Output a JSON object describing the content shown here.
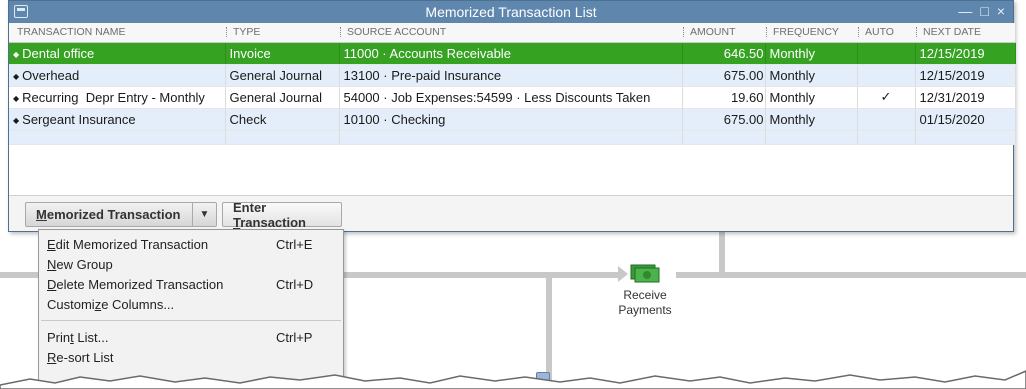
{
  "window": {
    "title": "Memorized Transaction List",
    "controls": [
      "—",
      "□",
      "×"
    ]
  },
  "table": {
    "columns": [
      "TRANSACTION NAME",
      "TYPE",
      "SOURCE ACCOUNT",
      "AMOUNT",
      "FREQUENCY",
      "AUTO",
      "NEXT DATE"
    ],
    "rows": [
      {
        "name": "Dental office",
        "type": "Invoice",
        "account": "11000 · Accounts Receivable",
        "amount": "646.50",
        "frequency": "Monthly",
        "auto": "",
        "next_date": "12/15/2019",
        "selected": true
      },
      {
        "name": "Overhead",
        "type": "General Journal",
        "account": "13100 · Pre-paid Insurance",
        "amount": "675.00",
        "frequency": "Monthly",
        "auto": "",
        "next_date": "12/15/2019",
        "selected": false
      },
      {
        "name": "Recurring  Depr Entry - Monthly",
        "type": "General Journal",
        "account": "54000 · Job Expenses:54599 · Less Discounts Taken",
        "amount": "19.60",
        "frequency": "Monthly",
        "auto": "✓",
        "next_date": "12/31/2019",
        "selected": false
      },
      {
        "name": "Sergeant Insurance",
        "type": "Check",
        "account": "10100 · Checking",
        "amount": "675.00",
        "frequency": "Monthly",
        "auto": "",
        "next_date": "01/15/2020",
        "selected": false
      }
    ]
  },
  "buttons": {
    "memorized_pre": "",
    "memorized_u": "M",
    "memorized_post": "emorized Transaction",
    "dropdown_icon": "▼",
    "enter_pre": "Enter ",
    "enter_u": "T",
    "enter_post": "ransaction"
  },
  "menu": {
    "items": [
      {
        "pre": "",
        "u": "E",
        "post": "dit Memorized Transaction",
        "shortcut": "Ctrl+E"
      },
      {
        "pre": "",
        "u": "N",
        "post": "ew Group",
        "shortcut": ""
      },
      {
        "pre": "",
        "u": "D",
        "post": "elete Memorized Transaction",
        "shortcut": "Ctrl+D"
      },
      {
        "pre": "Customi",
        "u": "z",
        "post": "e Columns...",
        "shortcut": ""
      },
      {
        "pre": "Prin",
        "u": "t",
        "post": " List...",
        "shortcut": "Ctrl+P"
      },
      {
        "pre": "",
        "u": "R",
        "post": "e-sort List",
        "shortcut": ""
      }
    ]
  },
  "home": {
    "receive_line1": "Receive",
    "receive_line2": "Payments",
    "money_icon": "money-icon",
    "accent": "#35a321"
  }
}
